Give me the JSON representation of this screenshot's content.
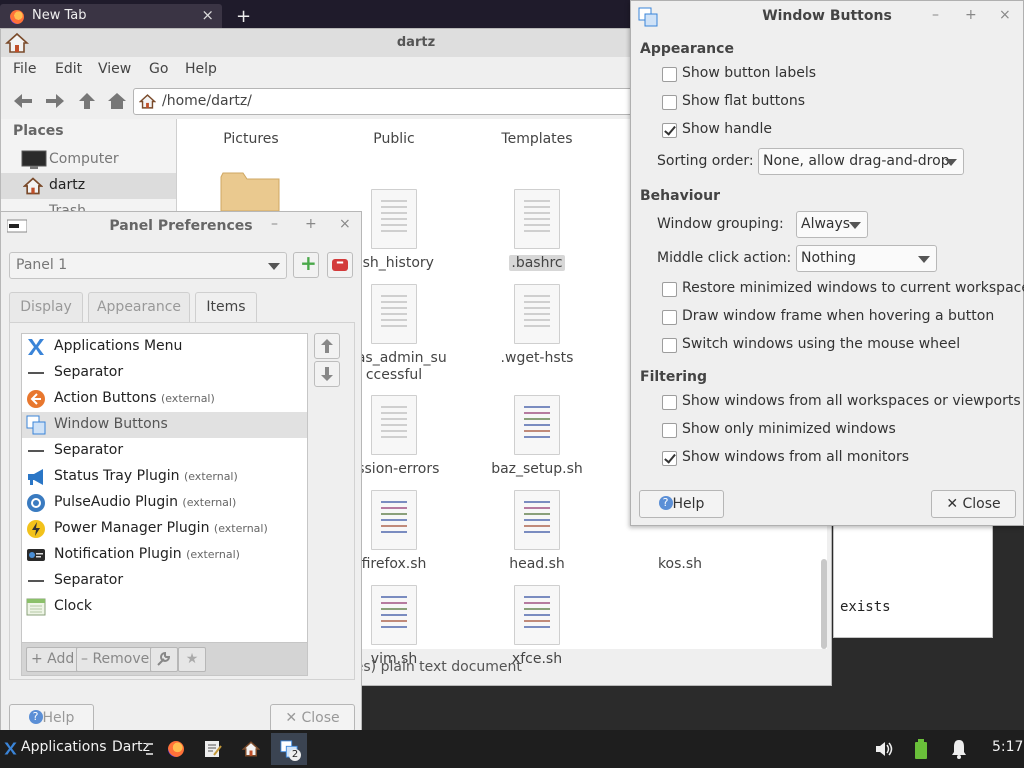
{
  "browser": {
    "tab_title": "New Tab",
    "new_tab": "+",
    "close": "×"
  },
  "thunar": {
    "title": "dartz",
    "menu": [
      "File",
      "Edit",
      "View",
      "Go",
      "Help"
    ],
    "location": "/home/dartz/",
    "sidebar": {
      "heading": "Places",
      "items": [
        {
          "label": "Computer",
          "icon": "computer-icon"
        },
        {
          "label": "dartz",
          "icon": "home-icon"
        },
        {
          "label": "Trash",
          "icon": "trash-icon"
        }
      ]
    },
    "files": [
      {
        "name": "Pictures"
      },
      {
        "name": "Public"
      },
      {
        "name": "Templates"
      },
      {
        "name": "ash_history"
      },
      {
        "name": ".bashrc"
      },
      {
        "name": "o_as_admin_su ccessful"
      },
      {
        "name": ".wget-hsts"
      },
      {
        "name": "ession-errors"
      },
      {
        "name": "baz_setup.sh"
      },
      {
        "name": "firefox.sh"
      },
      {
        "name": "head.sh"
      },
      {
        "name": "kos.sh"
      },
      {
        "name": "vim.sh"
      },
      {
        "name": "xfce.sh"
      }
    ],
    "status": "ytes) plain text document"
  },
  "terminal": {
    "text": "exists"
  },
  "panel_prefs": {
    "title": "Panel Preferences",
    "wm_minimize": "–",
    "wm_maximize": "+",
    "wm_close": "×",
    "panel_combo": "Panel 1",
    "add_panel": "+",
    "remove_panel": "–",
    "tabs": [
      "Display",
      "Appearance",
      "Items"
    ],
    "items": [
      {
        "label": "Applications Menu",
        "ext": "",
        "icon": "applications-menu-icon"
      },
      {
        "label": "Separator",
        "ext": "",
        "icon": "separator-icon"
      },
      {
        "label": "Action Buttons",
        "ext": "(external)",
        "icon": "action-buttons-icon"
      },
      {
        "label": "Window Buttons",
        "ext": "",
        "icon": "window-buttons-icon"
      },
      {
        "label": "Separator",
        "ext": "",
        "icon": "separator-icon"
      },
      {
        "label": "Status Tray Plugin",
        "ext": "(external)",
        "icon": "megaphone-icon"
      },
      {
        "label": "PulseAudio Plugin",
        "ext": "(external)",
        "icon": "speaker-icon"
      },
      {
        "label": "Power Manager Plugin",
        "ext": "(external)",
        "icon": "power-icon"
      },
      {
        "label": "Notification Plugin",
        "ext": "(external)",
        "icon": "notification-icon"
      },
      {
        "label": "Separator",
        "ext": "",
        "icon": "separator-icon"
      },
      {
        "label": "Clock",
        "ext": "",
        "icon": "clock-icon"
      }
    ],
    "selected_index": 3,
    "bottom": {
      "add": "+ Add",
      "remove": "– Remove"
    },
    "help": "Help",
    "close": "✕ Close"
  },
  "window_buttons": {
    "title": "Window Buttons",
    "wm_minimize": "–",
    "wm_maximize": "+",
    "wm_close": "×",
    "appearance": {
      "heading": "Appearance",
      "show_button_labels": {
        "label": "Show button labels",
        "checked": false
      },
      "show_flat_buttons": {
        "label": "Show flat buttons",
        "checked": false
      },
      "show_handle": {
        "label": "Show handle",
        "checked": true
      },
      "sorting_label": "Sorting order:",
      "sorting_value": "None, allow drag-and-drop"
    },
    "behaviour": {
      "heading": "Behaviour",
      "grouping_label": "Window grouping:",
      "grouping_value": "Always",
      "middle_label": "Middle click action:",
      "middle_value": "Nothing",
      "restore_minimized": {
        "label": "Restore minimized windows to current workspace",
        "checked": false
      },
      "draw_frame": {
        "label": "Draw window frame when hovering a button",
        "checked": false
      },
      "switch_wheel": {
        "label": "Switch windows using the mouse wheel",
        "checked": false
      }
    },
    "filtering": {
      "heading": "Filtering",
      "all_workspaces": {
        "label": "Show windows from all workspaces or viewports",
        "checked": false
      },
      "only_minimized": {
        "label": "Show only minimized windows",
        "checked": false
      },
      "all_monitors": {
        "label": "Show windows from all monitors",
        "checked": true
      }
    },
    "help": "Help",
    "close": "✕ Close"
  },
  "taskbar": {
    "applications": "Applications",
    "workspace": "Dartz",
    "badge": "2",
    "clock": "5:17"
  },
  "colors": {
    "accent": "#3a84d8",
    "taskbar": "#1e1e1e",
    "add_green": "#4aa84a",
    "remove_red": "#d33a3a"
  }
}
